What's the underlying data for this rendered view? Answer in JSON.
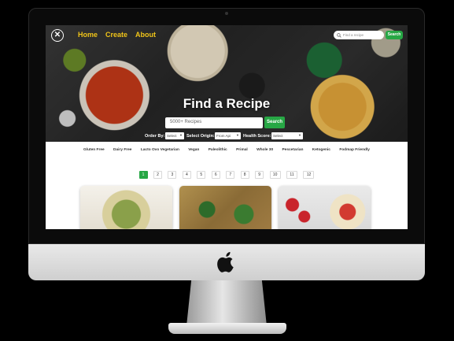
{
  "nav": {
    "links": [
      "Home",
      "Create",
      "About"
    ],
    "search_placeholder": "Find a recipe",
    "search_button": "Search"
  },
  "hero": {
    "title": "Find a Recipe",
    "search_placeholder": "5000+ Recipes",
    "search_button": "Search"
  },
  "filters": {
    "order_label": "Order By:",
    "order_value": "Select",
    "origin_label": "Select Origin:",
    "origin_value": "From Api",
    "health_label": "Health Score:",
    "health_value": "Select"
  },
  "diets": [
    "Gluten Free",
    "Dairy Free",
    "Lacto Ovo Vegetarian",
    "Vegan",
    "Paleolithic",
    "Primal",
    "Whole 30",
    "Pescetarian",
    "Ketogenic",
    "Fodmap Friendly"
  ],
  "pagination": {
    "pages": [
      "1",
      "2",
      "3",
      "4",
      "5",
      "6",
      "7",
      "8",
      "9",
      "10",
      "11",
      "12"
    ],
    "active_page": "1"
  },
  "colors": {
    "accent_green": "#27a745",
    "nav_link": "#f0c419"
  }
}
